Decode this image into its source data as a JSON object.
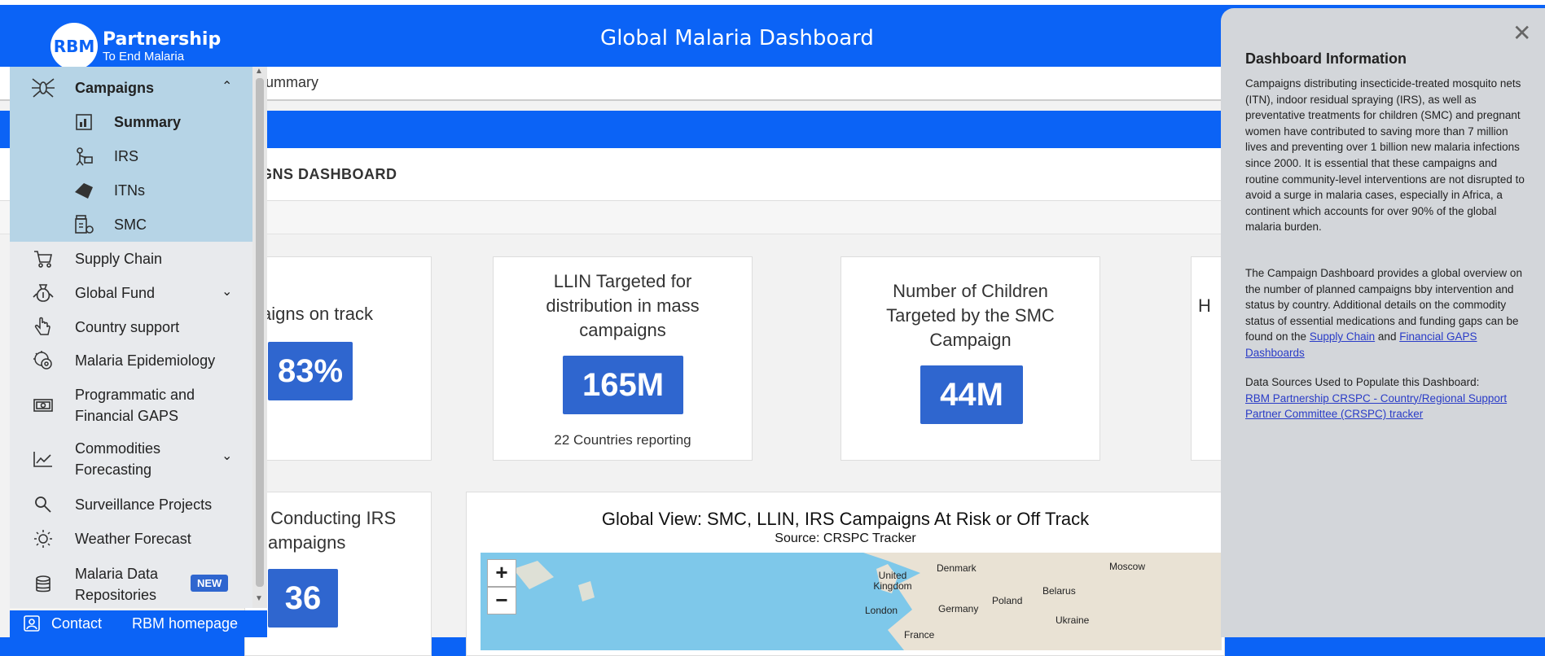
{
  "header": {
    "title": "Global Malaria Dashboard",
    "logo_mark": "RBM",
    "logo_name": "Partnership",
    "logo_tagline": "To End Malaria"
  },
  "breadcrumb": {
    "text": "ummary"
  },
  "section": {
    "heading": "GNS DASHBOARD"
  },
  "cards": {
    "card1": {
      "title": "aigns on track",
      "value": "83%"
    },
    "card2": {
      "title_lines": [
        "LLIN Targeted for",
        "distribution in mass",
        "campaigns"
      ],
      "value": "165M",
      "footer_num": "22",
      "footer_text": "Countries reporting"
    },
    "card3": {
      "title_lines": [
        "Number of Children",
        "Targeted by the SMC",
        "Campaign"
      ],
      "value": "44M"
    },
    "card4": {
      "title": "H"
    },
    "card5": {
      "title_lines": [
        "s Conducting IRS",
        "ampaigns"
      ],
      "value": "36"
    }
  },
  "map": {
    "title": "Global View: SMC, LLIN, IRS Campaigns At Risk or Off Track",
    "subtitle": "Source: CRSPC Tracker",
    "zoom_in": "+",
    "zoom_out": "−",
    "labels": [
      "Denmark",
      "Moscow",
      "United Kingdom",
      "Belarus",
      "Poland",
      "London",
      "Germany",
      "Ukraine",
      "France"
    ]
  },
  "sidebar": {
    "campaigns": {
      "label": "Campaigns",
      "icon": "mosquito-icon"
    },
    "sub": [
      {
        "label": "Summary",
        "icon": "summary-icon"
      },
      {
        "label": "IRS",
        "icon": "spray-icon"
      },
      {
        "label": "ITNs",
        "icon": "net-icon"
      },
      {
        "label": "SMC",
        "icon": "medicine-icon"
      }
    ],
    "items": [
      {
        "label": "Supply Chain",
        "icon": "cart-icon"
      },
      {
        "label": "Global Fund",
        "icon": "money-bag-icon"
      },
      {
        "label": "Country support",
        "icon": "hand-icon"
      },
      {
        "label": "Malaria Epidemiology",
        "icon": "virus-icon"
      },
      {
        "label_1": "Programmatic and",
        "label_2": "Financial GAPS",
        "icon": "cash-icon"
      },
      {
        "label_1": "Commodities",
        "label_2": "Forecasting",
        "icon": "chart-icon"
      },
      {
        "label": "Surveillance Projects",
        "icon": "search-icon"
      },
      {
        "label": "Weather Forecast",
        "icon": "sun-icon"
      },
      {
        "label_1": "Malaria Data",
        "label_2": "Repositories",
        "icon": "database-icon",
        "badge": "NEW"
      }
    ]
  },
  "bottom": {
    "contact": "Contact",
    "homepage": "RBM homepage"
  },
  "panel": {
    "title": "Dashboard Information",
    "p1": "Campaigns distributing insecticide-treated mosquito nets (ITN), indoor residual spraying (IRS), as well as preventative treatments for children (SMC) and pregnant women have contributed to saving more than 7 million lives and preventing over 1 billion new malaria infections since 2000. It is essential that these campaigns and routine community-level interventions are not disrupted to avoid a surge in malaria cases, especially in Africa, a continent which accounts for over 90% of the global malaria burden.",
    "p2_pre": "The Campaign Dashboard provides a global overview on the number of planned campaigns bby intervention and status by country. Additional details on the commodity status of essential medications and funding gaps can be found on the",
    "p2_link1": "Supply Chain",
    "p2_and": "and",
    "p2_link2": "Financial GAPS Dashboards",
    "p3_label": "Data Sources Used to Populate this Dashboard:",
    "p3_link": "RBM Partnership CRSPC - Country/Regional Support Partner Committee (CRSPC) tracker"
  }
}
